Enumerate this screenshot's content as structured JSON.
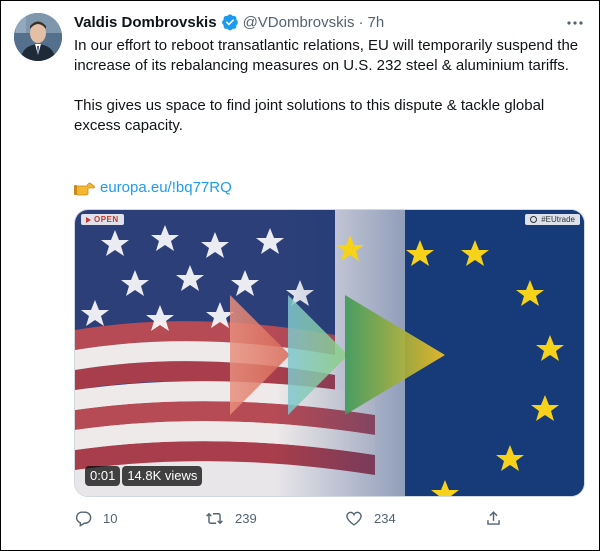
{
  "tweet": {
    "author_name": "Valdis Dombrovskis",
    "handle": "@VDombrovskis",
    "separator": "·",
    "time": "7h",
    "text_p1": "In our effort to reboot transatlantic relations, EU will temporarily suspend the increase of its rebalancing measures on U.S. 232 steel & aluminium tariffs.",
    "text_p2": "This gives us space to find joint solutions to this dispute & tackle global excess capacity.",
    "link_text": "europa.eu/!bq77RQ",
    "link_emoji": "pointing-right-hand-icon",
    "verified_color": "#1d9bf0"
  },
  "media": {
    "badge_open": "OPEN",
    "badge_tag": "#EUtrade",
    "video_time": "0:01",
    "view_count": "14.8K views"
  },
  "actions": {
    "reply_count": "10",
    "retweet_count": "239",
    "like_count": "234"
  },
  "icons": [
    "verified-badge-icon",
    "more-icon",
    "reply-icon",
    "retweet-icon",
    "like-icon",
    "share-icon"
  ]
}
